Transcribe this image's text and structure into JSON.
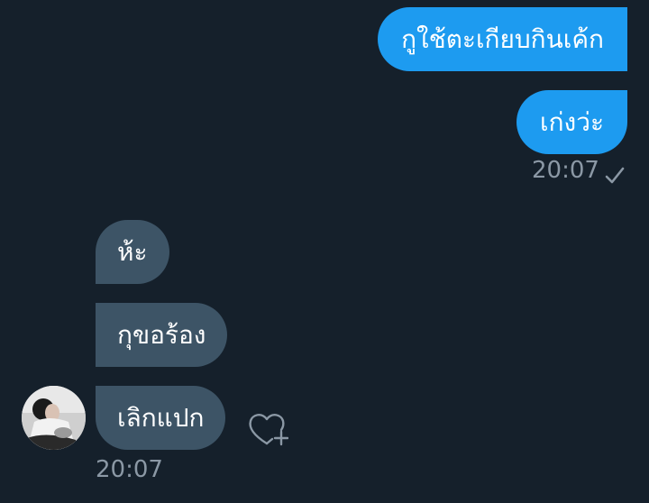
{
  "conversation": {
    "sent": [
      {
        "text": "กูใช้ตะเกียบกินเค้ก"
      },
      {
        "text": "เก่งว่ะ"
      }
    ],
    "sent_time": "20:07",
    "received": [
      {
        "text": "ห้ะ"
      },
      {
        "text": "กุขอร้อง"
      },
      {
        "text": "เลิกแปก"
      }
    ],
    "received_time": "20:07"
  },
  "icons": {
    "read_receipt": "checkmark-icon",
    "react": "heart-plus-icon",
    "avatar": "user-avatar"
  },
  "colors": {
    "background": "#15202b",
    "sent_bubble": "#1d9bf0",
    "received_bubble": "#3d5466",
    "timestamp": "#8b98a5"
  }
}
